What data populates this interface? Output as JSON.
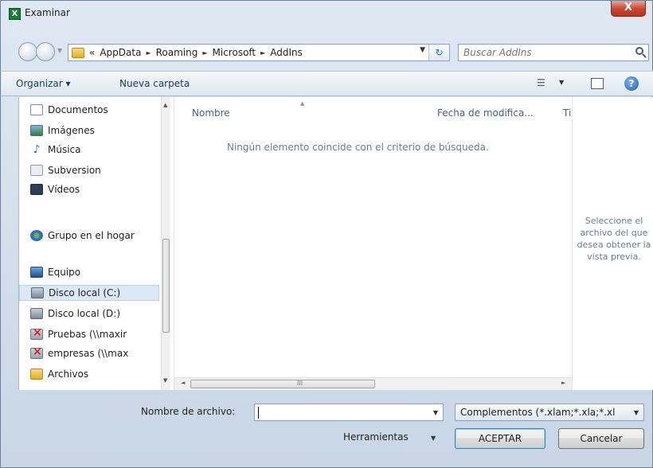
{
  "window": {
    "title": "Examinar",
    "close_label": "X",
    "app_icon_letter": "X"
  },
  "address": {
    "overflow": "«",
    "crumbs": [
      "AppData",
      "Roaming",
      "Microsoft",
      "AddIns"
    ],
    "separator": "►",
    "dropdown": "▼",
    "refresh": "↻"
  },
  "search": {
    "placeholder": "Buscar AddIns"
  },
  "toolbar": {
    "organize": "Organizar ▾",
    "new_folder": "Nueva carpeta",
    "view_icon": "☰",
    "view_drop": "▼",
    "help": "?"
  },
  "nav": {
    "items": [
      {
        "label": "Documentos",
        "icon": "document-icon"
      },
      {
        "label": "Imágenes",
        "icon": "images-icon"
      },
      {
        "label": "Música",
        "icon": "music-icon"
      },
      {
        "label": "Subversion",
        "icon": "subversion-icon"
      },
      {
        "label": "Vídeos",
        "icon": "videos-icon"
      },
      {
        "label": "Grupo en el hogar",
        "icon": "homegroup-icon"
      },
      {
        "label": "Equipo",
        "icon": "computer-icon"
      },
      {
        "label": "Disco local (C:)",
        "icon": "drive-icon",
        "selected": true
      },
      {
        "label": "Disco local (D:)",
        "icon": "drive-icon"
      },
      {
        "label": "Pruebas (\\\\maxir",
        "icon": "network-drive-icon"
      },
      {
        "label": "empresas (\\\\max",
        "icon": "network-drive-icon"
      },
      {
        "label": "Archivos",
        "icon": "folder-icon"
      }
    ]
  },
  "file_list": {
    "columns": [
      "Nombre",
      "Fecha de modifica...",
      "Ti"
    ],
    "empty_message": "Ningún elemento coincide con el criterio de búsqueda."
  },
  "preview": {
    "message": "Seleccione el archivo del que desea obtener la vista previa."
  },
  "bottom": {
    "filename_label": "Nombre de archivo:",
    "filename_value": "",
    "filetype_value": "Complementos (*.xlam;*.xla;*.xl",
    "tools_label": "Herramientas",
    "ok_label": "ACEPTAR",
    "cancel_label": "Cancelar"
  },
  "colors": {
    "selection": "#dce8f7",
    "accent": "#1e395b",
    "window_bg": "#dfe8f3"
  }
}
